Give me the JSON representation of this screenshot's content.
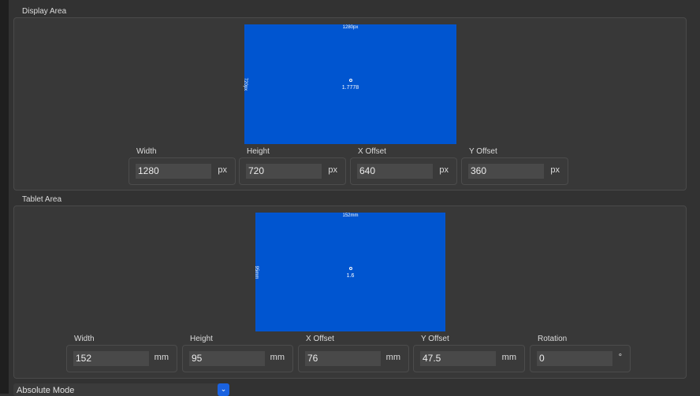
{
  "display": {
    "title": "Display Area",
    "width_label": "1280px",
    "height_label": "720px",
    "ratio": "1.7778",
    "fields": [
      {
        "label": "Width",
        "value": "1280",
        "unit": "px"
      },
      {
        "label": "Height",
        "value": "720",
        "unit": "px"
      },
      {
        "label": "X Offset",
        "value": "640",
        "unit": "px"
      },
      {
        "label": "Y Offset",
        "value": "360",
        "unit": "px"
      }
    ]
  },
  "tablet": {
    "title": "Tablet Area",
    "width_label": "152mm",
    "height_label": "95mm",
    "ratio": "1.6",
    "fields": [
      {
        "label": "Width",
        "value": "152",
        "unit": "mm"
      },
      {
        "label": "Height",
        "value": "95",
        "unit": "mm"
      },
      {
        "label": "X Offset",
        "value": "76",
        "unit": "mm"
      },
      {
        "label": "Y Offset",
        "value": "47.5",
        "unit": "mm"
      },
      {
        "label": "Rotation",
        "value": "0",
        "unit": "°"
      }
    ]
  },
  "mode": {
    "selected": "Absolute Mode"
  },
  "colors": {
    "area": "#0055d0",
    "accent": "#1a62e0"
  }
}
